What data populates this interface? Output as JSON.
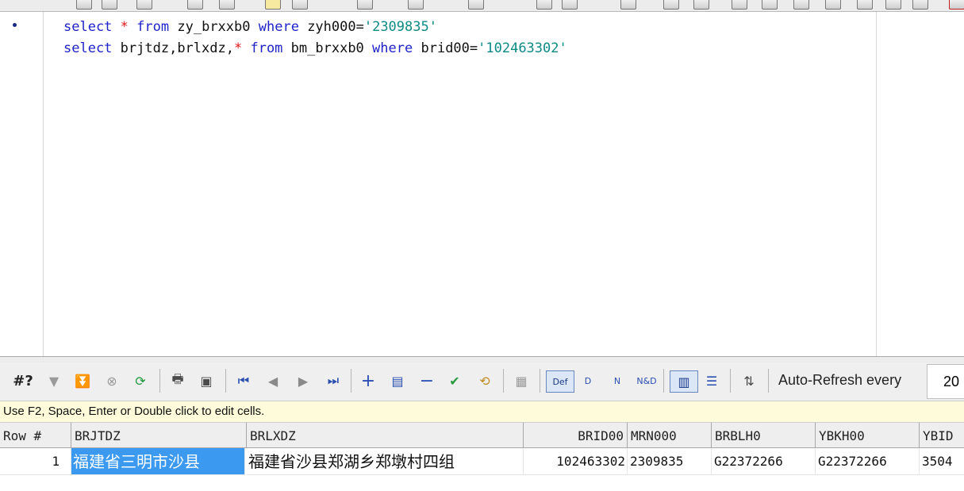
{
  "editor": {
    "lines": [
      {
        "select": "select",
        "star": "*",
        "from": "from",
        "table": "zy_brxxb0",
        "where": "where",
        "cond": "zyh000=",
        "val": "'2309835'"
      },
      {
        "select": "select",
        "cols": "brjtdz,brlxdz,",
        "star": "*",
        "from": "from",
        "table": "bm_brxxb0",
        "where": "where",
        "cond": "brid00=",
        "val": "'102463302'"
      }
    ]
  },
  "grid_toolbar": {
    "query_count_label": "#?",
    "auto_refresh_label": "Auto-Refresh every",
    "auto_refresh_value": "20"
  },
  "hint": "Use F2, Space, Enter or Double click to edit cells.",
  "grid": {
    "columns": [
      "Row #",
      "BRJTDZ",
      "BRLXDZ",
      "BRID00",
      "MRN000",
      "BRBLH0",
      "YBKH00",
      "YBID"
    ],
    "rows": [
      [
        "1",
        "福建省三明市沙县",
        "福建省沙县郑湖乡郑墩村四组",
        "102463302",
        "2309835",
        "G22372266",
        "G22372266",
        "3504"
      ]
    ]
  }
}
